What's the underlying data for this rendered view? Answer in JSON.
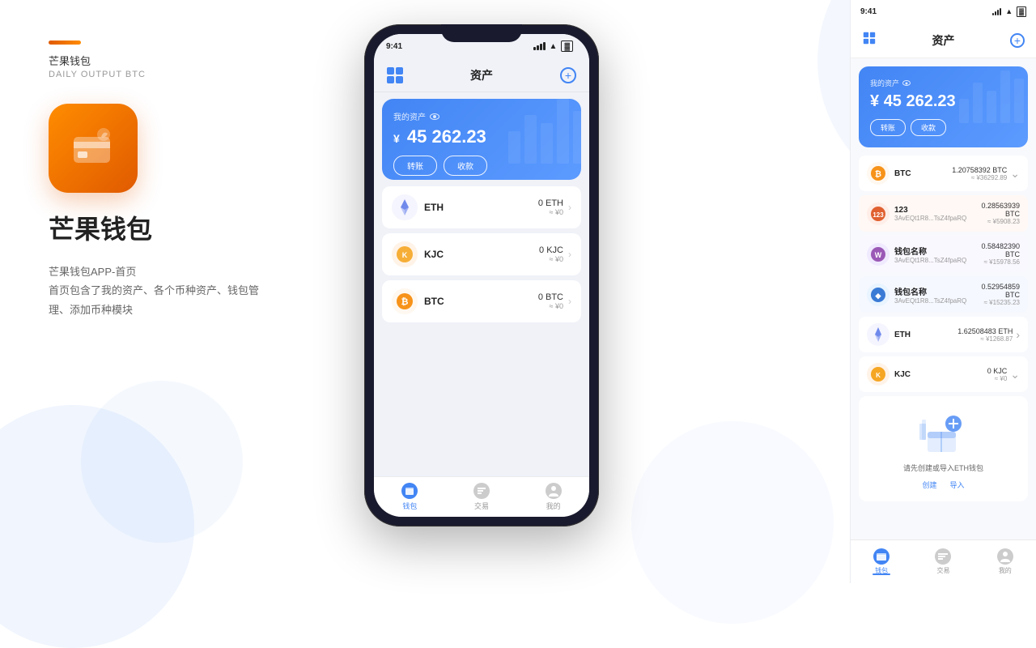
{
  "background": {
    "circles": [
      "blue-1",
      "blue-2",
      "blue-right",
      "blue-right2"
    ]
  },
  "left": {
    "brand_line": "",
    "brand_name_small": "芒果钱包",
    "brand_subtitle": "DAILY OUTPUT BTC",
    "app_title": "芒果钱包",
    "app_desc_line1": "芒果钱包APP-首页",
    "app_desc_line2": "首页包含了我的资产、各个币种资产、钱包管",
    "app_desc_line3": "理、添加币种模块"
  },
  "phone": {
    "status_time": "9:41",
    "nav_title": "资产",
    "assets_label": "我的资产",
    "assets_amount": "45 262.23",
    "assets_yen": "¥",
    "btn_transfer": "转账",
    "btn_receive": "收款",
    "coins": [
      {
        "name": "ETH",
        "balance": "0 ETH",
        "approx": "≈ ¥0",
        "color": "eth"
      },
      {
        "name": "KJC",
        "balance": "0 KJC",
        "approx": "≈ ¥0",
        "color": "kjc"
      },
      {
        "name": "BTC",
        "balance": "0 BTC",
        "approx": "≈ ¥0",
        "color": "btc"
      }
    ],
    "tabs": [
      {
        "label": "钱包",
        "active": true
      },
      {
        "label": "交易",
        "active": false
      },
      {
        "label": "我的",
        "active": false
      }
    ]
  },
  "right_panel": {
    "status_time": "9:41",
    "nav_title": "资产",
    "assets_label": "我的资产",
    "assets_amount": "45 262.23",
    "assets_yen": "¥",
    "btn_transfer": "转账",
    "btn_receive": "收款",
    "coins": [
      {
        "name": "BTC",
        "addr": "",
        "balance": "1.20758392 BTC",
        "cny": "≈ ¥36292.89",
        "color": "btc",
        "has_arrow": true,
        "has_detail": false
      },
      {
        "name": "123",
        "addr": "3AvEQt1R8...TsZ4fpaRQ",
        "balance": "0.28563939 BTC",
        "cny": "≈ ¥5908.23",
        "color": "123",
        "has_arrow": false,
        "has_detail": true
      },
      {
        "name": "钱包名称",
        "addr": "3AvEQt1R8...TsZ4fpaRQ",
        "balance": "0.58482390 BTC",
        "cny": "≈ ¥15978.56",
        "color": "purple",
        "has_arrow": false,
        "has_detail": true
      },
      {
        "name": "钱包名称",
        "addr": "3AvEQt1R8...TsZ4fpaRQ",
        "balance": "0.52954859 BTC",
        "cny": "≈ ¥15235.23",
        "color": "diamond",
        "has_arrow": false,
        "has_detail": true
      },
      {
        "name": "ETH",
        "addr": "",
        "balance": "1.62508483 ETH",
        "cny": "≈ ¥1268.87",
        "color": "eth",
        "has_arrow": true,
        "has_detail": false
      },
      {
        "name": "KJC",
        "addr": "",
        "balance": "0 KJC",
        "cny": "≈ ¥0",
        "color": "kjc",
        "has_arrow": true,
        "has_detail": false
      }
    ],
    "eth_prompt_text": "请先创建或导入ETH钱包",
    "eth_create": "创建",
    "eth_import": "导入",
    "tabs": [
      {
        "label": "钱包",
        "active": true
      },
      {
        "label": "交易",
        "active": false
      },
      {
        "label": "我的",
        "active": false
      }
    ]
  }
}
